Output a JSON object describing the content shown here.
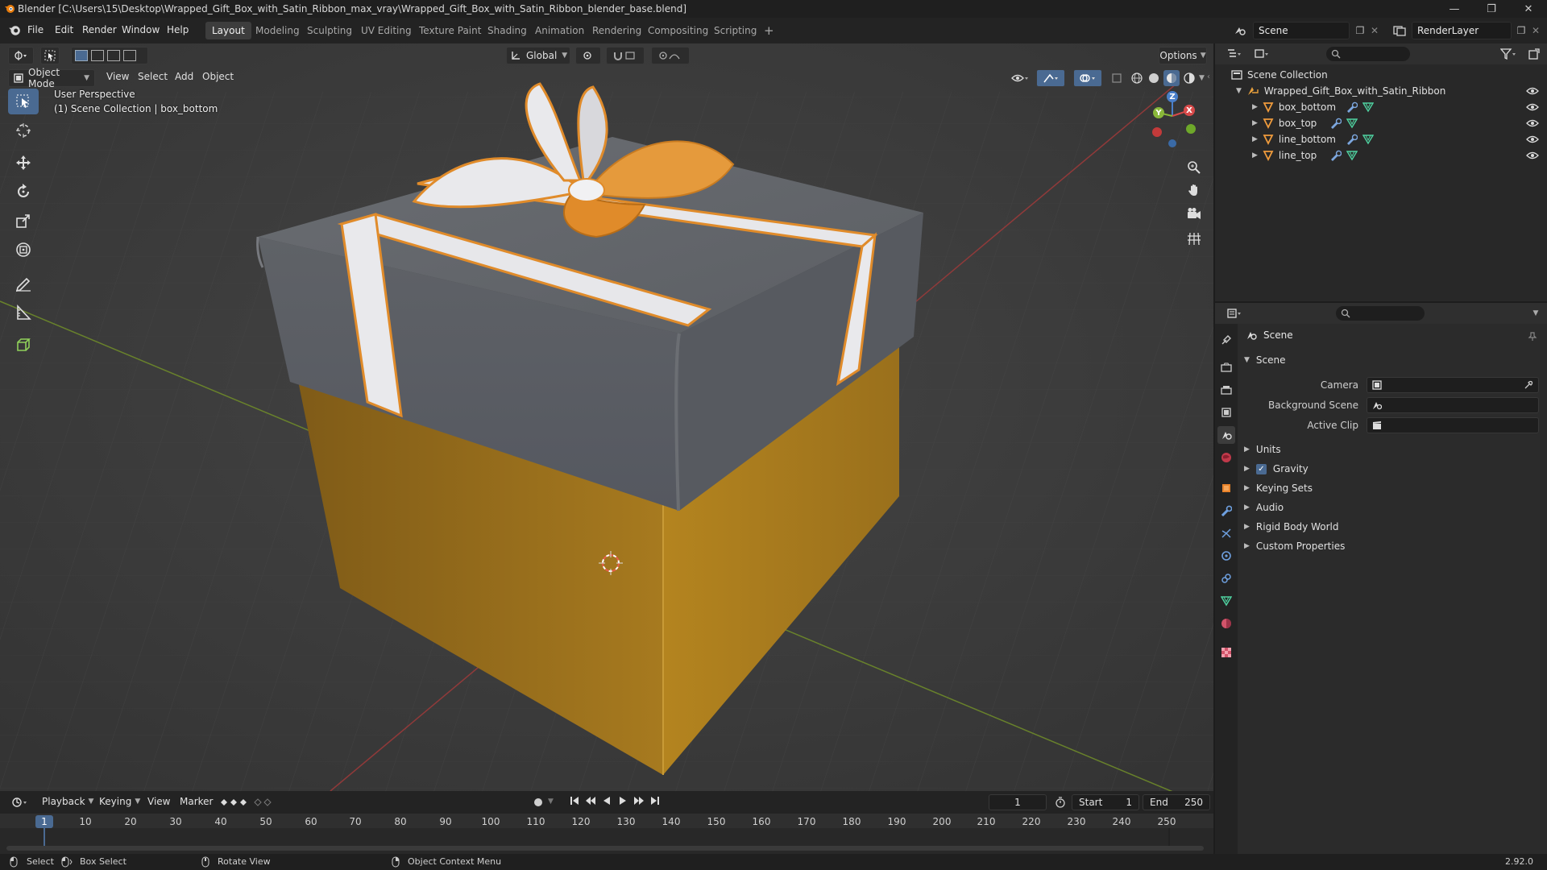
{
  "window": {
    "title": "Blender [C:\\Users\\15\\Desktop\\Wrapped_Gift_Box_with_Satin_Ribbon_max_vray\\Wrapped_Gift_Box_with_Satin_Ribbon_blender_base.blend]",
    "minimize": "—",
    "maximize": "❐",
    "close": "✕"
  },
  "menu": [
    "File",
    "Edit",
    "Render",
    "Window",
    "Help"
  ],
  "workspaces": [
    "Layout",
    "Modeling",
    "Sculpting",
    "UV Editing",
    "Texture Paint",
    "Shading",
    "Animation",
    "Rendering",
    "Compositing",
    "Scripting"
  ],
  "workspace_add": "+",
  "scene_selector": "Scene",
  "view_layer": "RenderLayer",
  "viewport": {
    "mode": "Object Mode",
    "menus": [
      "View",
      "Select",
      "Add",
      "Object"
    ],
    "transform_orientation": "Global",
    "options": "Options",
    "overlay_line1": "User Perspective",
    "overlay_line2": "(1) Scene Collection | box_bottom",
    "gizmo": {
      "x": "X",
      "y": "Y",
      "z": "Z"
    }
  },
  "tools": [
    "select-box",
    "cursor",
    "move",
    "rotate",
    "scale",
    "transform",
    "annotate",
    "measure",
    "add-cube"
  ],
  "outliner": {
    "root": "Scene Collection",
    "collection": "Wrapped_Gift_Box_with_Satin_Ribbon",
    "objects": [
      "box_bottom",
      "box_top",
      "line_bottom",
      "line_top"
    ]
  },
  "properties": {
    "scene_name": "Scene",
    "panel_title": "Scene",
    "camera_label": "Camera",
    "background_scene_label": "Background Scene",
    "active_clip_label": "Active Clip",
    "subpanels": [
      "Units",
      "Gravity",
      "Keying Sets",
      "Audio",
      "Rigid Body World",
      "Custom Properties"
    ],
    "gravity_checked": true
  },
  "timeline": {
    "menus": [
      "Playback",
      "Keying",
      "View",
      "Marker"
    ],
    "current_frame": "1",
    "start_label": "Start",
    "start_value": "1",
    "end_label": "End",
    "end_value": "250",
    "playhead": "1",
    "ticks": [
      "10",
      "20",
      "30",
      "40",
      "50",
      "60",
      "70",
      "80",
      "90",
      "100",
      "110",
      "120",
      "130",
      "140",
      "150",
      "160",
      "170",
      "180",
      "190",
      "200",
      "210",
      "220",
      "230",
      "240",
      "250"
    ]
  },
  "status": {
    "select": "Select",
    "box_select": "Box Select",
    "rotate_view": "Rotate View",
    "context_menu": "Object Context Menu",
    "version": "2.92.0"
  },
  "colors": {
    "accent": "#4a6a92",
    "box_bottom": "#b5831f",
    "box_lid": "#6b6e73",
    "ribbon": "#e9e9ec",
    "ribbon_edge": "#e08b2a"
  }
}
